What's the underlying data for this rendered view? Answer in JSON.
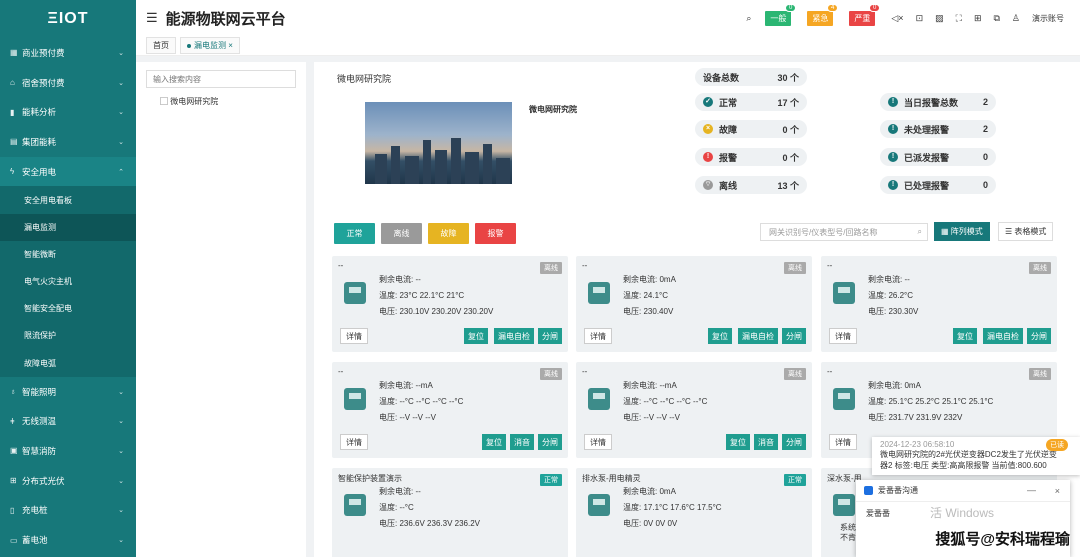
{
  "app": {
    "logo": "ΞIOT",
    "title": "能源物联网云平台"
  },
  "header": {
    "badges": [
      {
        "label": "一般",
        "count": "0",
        "color": "#2bb673"
      },
      {
        "label": "紧急",
        "count": "4",
        "color": "#f5a623"
      },
      {
        "label": "严重",
        "count": "0",
        "color": "#e94444"
      }
    ],
    "user": "演示账号"
  },
  "sidebar": {
    "items": [
      {
        "label": "商业预付费",
        "icon": "building-icon"
      },
      {
        "label": "宿舍预付费",
        "icon": "home-icon"
      },
      {
        "label": "能耗分析",
        "icon": "chart-icon"
      },
      {
        "label": "集团能耗",
        "icon": "document-icon"
      },
      {
        "label": "安全用电",
        "icon": "bolt-icon"
      }
    ],
    "sub": [
      "安全用电看板",
      "漏电监测",
      "智能微断",
      "电气火灾主机",
      "智能安全配电",
      "限流保护",
      "故障电弧"
    ],
    "items2": [
      {
        "label": "智能照明",
        "icon": "bulb-icon"
      },
      {
        "label": "无线测温",
        "icon": "thermometer-icon"
      },
      {
        "label": "智慧消防",
        "icon": "fire-icon"
      },
      {
        "label": "分布式光伏",
        "icon": "solar-icon"
      },
      {
        "label": "充电桩",
        "icon": "charger-icon"
      },
      {
        "label": "蓄电池",
        "icon": "battery-icon"
      }
    ]
  },
  "breadcrumb": {
    "home": "首页",
    "current": "漏电监测"
  },
  "tree": {
    "placeholder": "输入搜索内容",
    "node": "微电网研究院"
  },
  "site": {
    "name": "微电网研究院",
    "label": "微电网研究院"
  },
  "stats": {
    "total": {
      "label": "设备总数",
      "value": "30 个"
    },
    "normal": {
      "label": "正常",
      "value": "17 个"
    },
    "fault": {
      "label": "故障",
      "value": "0 个"
    },
    "alarm": {
      "label": "报警",
      "value": "0 个"
    },
    "offline": {
      "label": "离线",
      "value": "13 个"
    },
    "today": {
      "label": "当日报警总数",
      "value": "2"
    },
    "unhandled": {
      "label": "未处理报警",
      "value": "2"
    },
    "dispatched": {
      "label": "已派发报警",
      "value": "0"
    },
    "handled": {
      "label": "已处理报警",
      "value": "0"
    }
  },
  "filters": {
    "normal": "正常",
    "offline": "离线",
    "fault": "故障",
    "alarm": "报警"
  },
  "search": {
    "placeholder": "网关识别号/仪表型号/回路名称"
  },
  "modes": {
    "grid": "阵列模式",
    "table": "表格模式"
  },
  "labels": {
    "leak": "剩余电流:",
    "temp": "温度:",
    "volt": "电压:",
    "detail": "详情",
    "reset": "复位",
    "selftest": "漏电自检",
    "open": "分闸",
    "mute": "消音"
  },
  "cards": [
    {
      "title": "--",
      "status": "离线",
      "leak": "--",
      "temp": "23°C 22.1°C 21°C",
      "volt": "230.10V 230.20V 230.20V",
      "actions": [
        "复位",
        "漏电自检",
        "分闸"
      ]
    },
    {
      "title": "--",
      "status": "离线",
      "leak": "0mA",
      "temp": "24.1°C",
      "volt": "230.40V",
      "actions": [
        "复位",
        "漏电自检",
        "分闸"
      ]
    },
    {
      "title": "--",
      "status": "离线",
      "leak": "--",
      "temp": "26.2°C",
      "volt": "230.30V",
      "actions": [
        "复位",
        "漏电自检",
        "分闸"
      ]
    },
    {
      "title": "--",
      "status": "离线",
      "leak": "--mA",
      "temp": "--°C --°C --°C --°C",
      "volt": "--V --V --V",
      "actions": [
        "复位",
        "消音",
        "分闸"
      ]
    },
    {
      "title": "--",
      "status": "离线",
      "leak": "--mA",
      "temp": "--°C --°C --°C --°C",
      "volt": "--V --V --V",
      "actions": [
        "复位",
        "消音",
        "分闸"
      ]
    },
    {
      "title": "--",
      "status": "离线",
      "leak": "0mA",
      "temp": "25.1°C 25.2°C 25.1°C 25.1°C",
      "volt": "231.7V 231.9V 232V",
      "actions": []
    },
    {
      "title": "智能保护装置演示",
      "status": "正常",
      "leak": "--",
      "temp": "--°C",
      "volt": "236.6V 236.3V 236.2V",
      "actions": []
    },
    {
      "title": "排水泵-用电精灵",
      "status": "正常",
      "leak": "0mA",
      "temp": "17.1°C 17.6°C 17.5°C",
      "volt": "0V 0V 0V",
      "actions": []
    },
    {
      "title": "深水泵-用",
      "status": "",
      "leak": "",
      "temp": "",
      "volt": "",
      "actions": []
    }
  ],
  "notification": {
    "time": "2024-12-23 06:58:10",
    "tag": "已读",
    "text1": "微电网研究院的2#光伏逆变器DC2发生了光伏逆变",
    "text2": "器2 标签:电压 类型:高高限报警 当前值:800.600"
  },
  "popup": {
    "title": "爱番番沟通",
    "name": "爱番番",
    "text": "系统",
    "text2": "不肯",
    "ghost": "活 Windows"
  },
  "watermark": "搜狐号@安科瑞程瑜"
}
